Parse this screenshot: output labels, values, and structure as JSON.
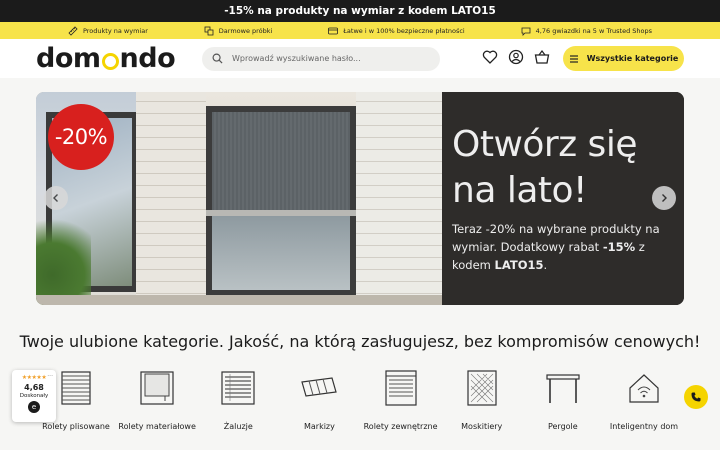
{
  "promo_bar": {
    "text": "-15% na produkty na wymiar z kodem LATO15"
  },
  "benefits": [
    {
      "icon": "ruler-icon",
      "label": "Produkty na wymiar"
    },
    {
      "icon": "samples-icon",
      "label": "Darmowe próbki"
    },
    {
      "icon": "card-icon",
      "label": "Łatwe i w 100% bezpieczne płatności"
    },
    {
      "icon": "chat-icon",
      "label": "4,76 gwiazdki na 5 w Trusted Shops"
    }
  ],
  "header": {
    "logo_part1": "dom",
    "logo_part2": "nd",
    "logo_part3": "o",
    "search_placeholder": "Wprowadź wyszukiwane hasło...",
    "all_categories_label": "Wszystkie kategorie"
  },
  "hero": {
    "badge": "-20%",
    "headline": "Otwórz się na lato!",
    "sub_part1": "Teraz -20% na wybrane produkty na wymiar. Dodatkowy rabat ",
    "sub_bold1": "-15%",
    "sub_part2": " z kodem ",
    "sub_bold2": "LATO15",
    "sub_part3": "."
  },
  "categories_section": {
    "title": "Twoje ulubione kategorie. Jakość, na którą zasługujesz, bez kompromisów cenowych!",
    "items": [
      {
        "label": "Rolety plisowane",
        "icon": "pleated-blind-icon"
      },
      {
        "label": "Rolety materiałowe",
        "icon": "roller-blind-icon"
      },
      {
        "label": "Żaluzje",
        "icon": "venetian-blind-icon"
      },
      {
        "label": "Markizy",
        "icon": "awning-icon"
      },
      {
        "label": "Rolety zewnętrzne",
        "icon": "external-shutter-icon"
      },
      {
        "label": "Moskitiery",
        "icon": "mosquito-net-icon"
      },
      {
        "label": "Pergole",
        "icon": "pergola-icon"
      },
      {
        "label": "Inteligentny dom",
        "icon": "smart-home-icon"
      }
    ]
  },
  "trust_widget": {
    "stars": "★★★★★",
    "score": "4,68",
    "label": "Doskonały",
    "seal": "e",
    "menu": "..."
  },
  "colors": {
    "accent_yellow": "#f7e34a",
    "badge_red": "#d8201e",
    "dark": "#1b1b1b"
  }
}
